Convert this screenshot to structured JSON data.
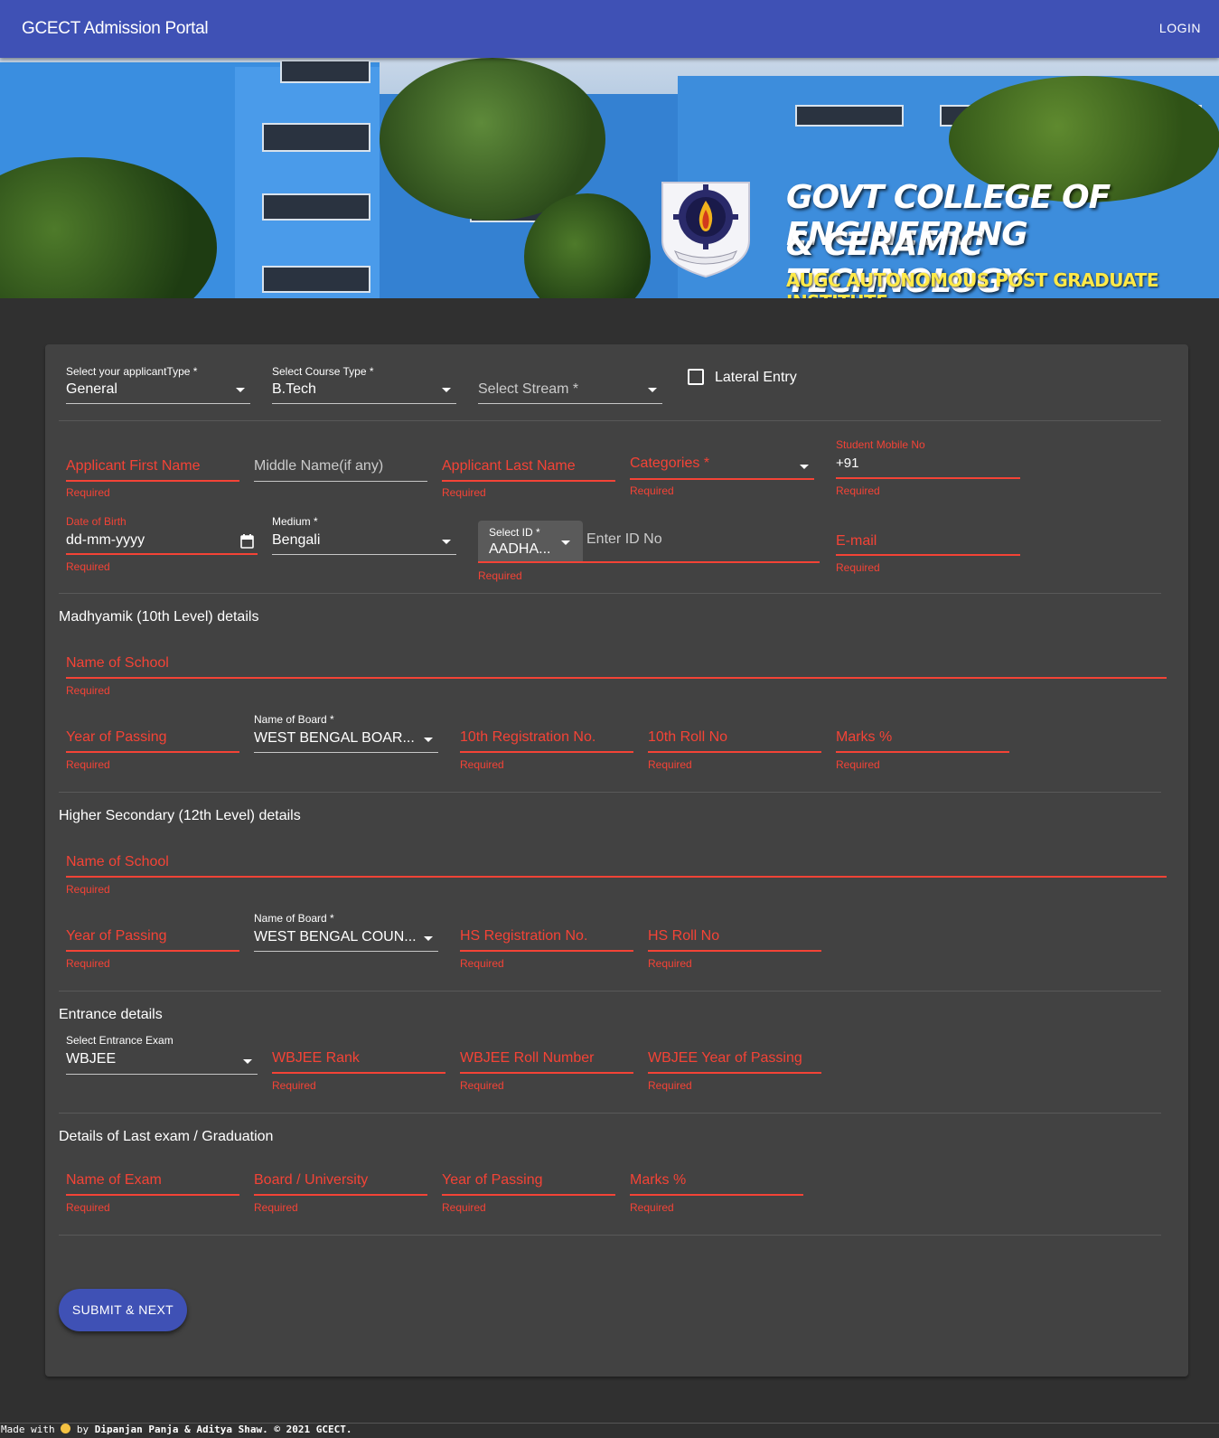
{
  "appbar": {
    "title": "GCECT Admission Portal",
    "login": "LOGIN"
  },
  "banner": {
    "line1": "GOVT COLLEGE OF ENGINEERING",
    "line2": "& CERAMIC TECHNOLOGY",
    "line3": "AUGC AUTONOMOUS POST GRADUATE INSTITUTE"
  },
  "row1": {
    "applicant_type_label": "Select your applicantType *",
    "applicant_type_value": "General",
    "course_type_label": "Select Course Type *",
    "course_type_value": "B.Tech",
    "stream_placeholder": "Select Stream *",
    "lateral_entry": "Lateral Entry"
  },
  "personal": {
    "first_name": "Applicant First Name",
    "middle_name": "Middle Name(if any)",
    "last_name": "Applicant Last Name",
    "categories": "Categories *",
    "mobile_label": "Student Mobile No",
    "mobile_value": "+91",
    "dob_label": "Date of Birth",
    "dob_value": "dd-mm-yyyy",
    "medium_label": "Medium *",
    "medium_value": "Bengali",
    "id_label": "Select ID *",
    "id_value": "AADHA...",
    "id_no": "Enter ID No",
    "email": "E-mail",
    "required": "Required"
  },
  "madhyamik": {
    "heading": "Madhyamik (10th Level) details",
    "school": "Name of School",
    "year": "Year of Passing",
    "board_label": "Name of Board *",
    "board_value": "WEST BENGAL BOAR...",
    "reg_no": "10th Registration No.",
    "roll_no": "10th Roll No",
    "marks": "Marks %"
  },
  "hs": {
    "heading": "Higher Secondary (12th Level) details",
    "school": "Name of School",
    "year": "Year of Passing",
    "board_label": "Name of Board *",
    "board_value": "WEST BENGAL COUN...",
    "reg_no": "HS Registration No.",
    "roll_no": "HS Roll No"
  },
  "entrance": {
    "heading": "Entrance details",
    "exam_label": "Select Entrance Exam",
    "exam_value": "WBJEE",
    "rank": "WBJEE Rank",
    "roll": "WBJEE Roll Number",
    "year": "WBJEE Year of Passing"
  },
  "last_exam": {
    "heading": "Details of Last exam / Graduation",
    "name": "Name of Exam",
    "board": "Board / University",
    "year": "Year of Passing",
    "marks": "Marks %"
  },
  "submit": "SUBMIT & NEXT",
  "footer": {
    "made_with": "Made with",
    "by": "by",
    "authors": "Dipanjan Panja & Aditya Shaw.",
    "copyright": "© 2021 GCECT."
  },
  "colors": {
    "primary": "#3f51b5",
    "error": "#f44336",
    "card": "#424242",
    "background": "#303030",
    "banner_subtitle": "#ffe948"
  }
}
